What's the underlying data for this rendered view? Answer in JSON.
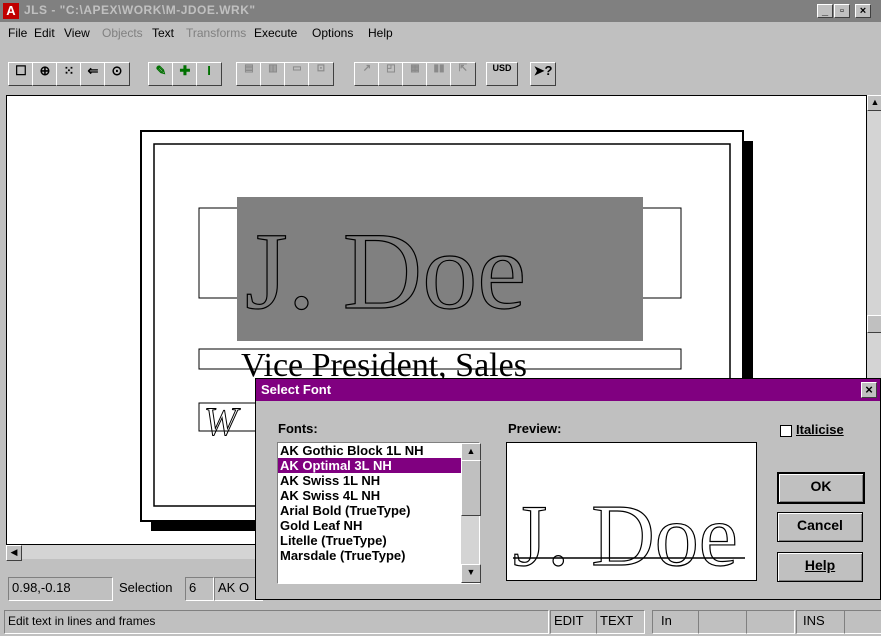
{
  "window": {
    "title": "JLS - \"C:\\APEX\\WORK\\M-JDOE.WRK\"",
    "app_icon_glyph": "A",
    "minimize": "_",
    "restore": "▫",
    "close": "×"
  },
  "menu": [
    {
      "label": "File",
      "enabled": true
    },
    {
      "label": "Edit",
      "enabled": true
    },
    {
      "label": "View",
      "enabled": true
    },
    {
      "label": "Objects",
      "enabled": false
    },
    {
      "label": "Text",
      "enabled": true
    },
    {
      "label": "Transforms",
      "enabled": false
    },
    {
      "label": "Execute",
      "enabled": true
    },
    {
      "label": "Options",
      "enabled": true
    },
    {
      "label": "Help",
      "enabled": true
    }
  ],
  "toolbar": {
    "usd_label": "USD",
    "icons": [
      "select-rect-icon",
      "zoom-icon",
      "grid-icon",
      "back-icon",
      "view-icon",
      "pen-icon",
      "add-icon",
      "text-cursor-icon",
      "align-icon",
      "columns-icon",
      "frame-icon",
      "rotate-icon",
      "skew-icon",
      "layout-icon",
      "merge-icon",
      "split-icon",
      "export-icon",
      "usd-icon",
      "help-pointer-icon"
    ]
  },
  "canvas": {
    "name_text": "J. Doe",
    "title_text": "Vice President, Sales",
    "partial_text": "W"
  },
  "status": {
    "coords": "0.98,-0.18",
    "selection_label": "Selection",
    "selection_count": "6",
    "font_partial": "AK O",
    "message": "Edit text in lines and frames",
    "mode_edit": "EDIT",
    "mode_text": "TEXT",
    "unit": "In",
    "ins": "INS"
  },
  "dialog": {
    "title": "Select Font",
    "close": "×",
    "fonts_label": "Fonts:",
    "preview_label": "Preview:",
    "italicise_label": "Italicise",
    "italicise_checked": false,
    "fonts": [
      "AK Gothic Block 1L NH",
      "AK Optimal 3L NH",
      "AK Swiss 1L NH",
      "AK Swiss 4L NH",
      "Arial Bold (TrueType)",
      "Gold Leaf NH",
      "Litelle (TrueType)",
      "Marsdale (TrueType)"
    ],
    "selected_index": 1,
    "preview_text": "J. Doe",
    "ok": "OK",
    "cancel": "Cancel",
    "help": "Help"
  },
  "colors": {
    "accent": "#800080",
    "title_inactive": "#808080",
    "selection_fill": "#808080"
  }
}
